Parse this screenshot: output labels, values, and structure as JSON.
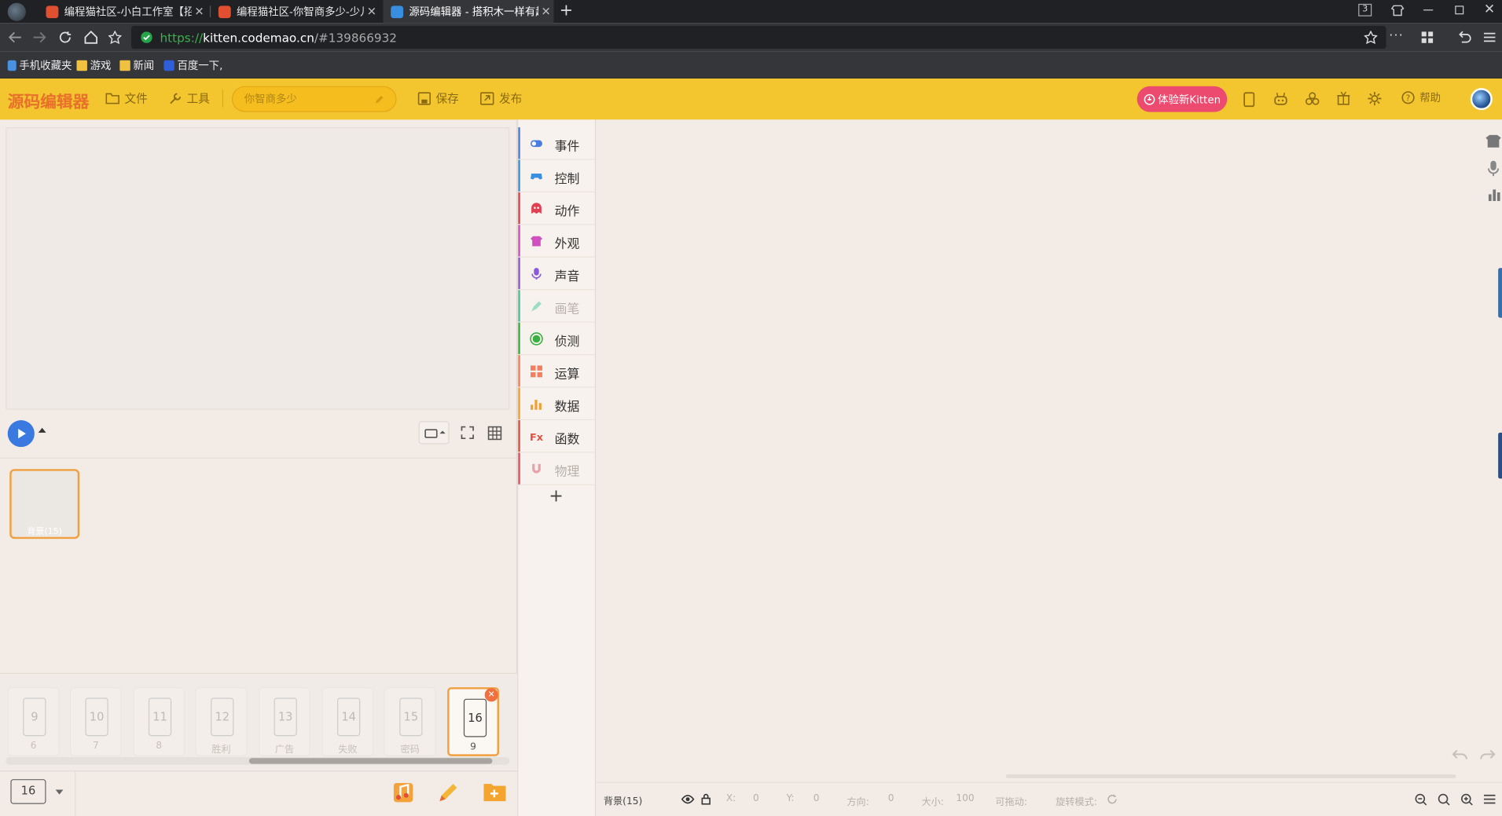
{
  "browser": {
    "tabs": [
      {
        "title": "编程猫社区-小白工作室【招人",
        "active": false
      },
      {
        "title": "编程猫社区-你智商多少-少儿编",
        "active": false
      },
      {
        "title": "源码编辑器 - 搭积木一样有趣",
        "active": true
      }
    ],
    "tab_count": "3",
    "url_https": "https://",
    "url_domain": "kitten.codemao.cn",
    "url_path": "/#139866932",
    "bookmarks": [
      "手机收藏夹",
      "游戏",
      "新闻",
      "百度一下,"
    ]
  },
  "header": {
    "logo": "源码编辑器",
    "file_label": "文件",
    "tools_label": "工具",
    "project_name": "你智商多少",
    "save_label": "保存",
    "publish_label": "发布",
    "try_new_label": "体验新Kitten",
    "help_label": "帮助"
  },
  "categories": [
    {
      "label": "事件",
      "color": "#4a7de0",
      "dim": false
    },
    {
      "label": "控制",
      "color": "#3a90e0",
      "dim": false
    },
    {
      "label": "动作",
      "color": "#e04050",
      "dim": false
    },
    {
      "label": "外观",
      "color": "#d050c0",
      "dim": false
    },
    {
      "label": "声音",
      "color": "#8a5ad8",
      "dim": false
    },
    {
      "label": "画笔",
      "color": "#4ac0a0",
      "dim": true
    },
    {
      "label": "侦测",
      "color": "#3ab040",
      "dim": false
    },
    {
      "label": "运算",
      "color": "#f08060",
      "dim": false
    },
    {
      "label": "数据",
      "color": "#f0a030",
      "dim": false
    },
    {
      "label": "函数",
      "color": "#e05040",
      "dim": false
    },
    {
      "label": "物理",
      "color": "#e05060",
      "dim": true
    }
  ],
  "sprite": {
    "label": "背景(15)"
  },
  "pages": [
    {
      "num": "9",
      "label": "6"
    },
    {
      "num": "10",
      "label": "7"
    },
    {
      "num": "11",
      "label": "8"
    },
    {
      "num": "12",
      "label": "胜利"
    },
    {
      "num": "13",
      "label": "广告"
    },
    {
      "num": "14",
      "label": "失败"
    },
    {
      "num": "15",
      "label": "密码"
    },
    {
      "num": "16",
      "label": "9"
    }
  ],
  "footer": {
    "page_count": "16"
  },
  "status": {
    "name": "背景(15)",
    "x_label": "X:",
    "x_value": "0",
    "y_label": "Y:",
    "y_value": "0",
    "dir_label": "方向:",
    "dir_value": "0",
    "size_label": "大小:",
    "size_value": "100",
    "drag_label": "可拖动:",
    "rotate_label": "旋转模式:"
  }
}
